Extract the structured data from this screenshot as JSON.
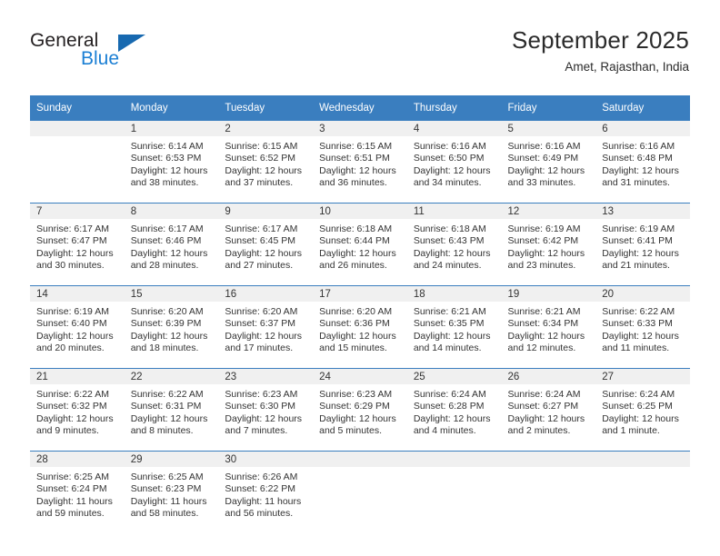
{
  "brand": {
    "name_part1": "General",
    "name_part2": "Blue",
    "triangle_icon": "triangle-icon",
    "accent_color": "#1769b0",
    "blue_text_color": "#1b7fd4"
  },
  "header": {
    "month_title": "September 2025",
    "location": "Amet, Rajasthan, India"
  },
  "calendar": {
    "header_bg_color": "#3a7ebf",
    "daynum_bg_color": "#f0f0f0",
    "weekdays": [
      "Sunday",
      "Monday",
      "Tuesday",
      "Wednesday",
      "Thursday",
      "Friday",
      "Saturday"
    ],
    "weeks": [
      [
        {
          "day": "",
          "sunrise": "",
          "sunset": "",
          "daylight_line1": "",
          "daylight_line2": "",
          "empty": true
        },
        {
          "day": "1",
          "sunrise": "Sunrise: 6:14 AM",
          "sunset": "Sunset: 6:53 PM",
          "daylight_line1": "Daylight: 12 hours",
          "daylight_line2": "and 38 minutes."
        },
        {
          "day": "2",
          "sunrise": "Sunrise: 6:15 AM",
          "sunset": "Sunset: 6:52 PM",
          "daylight_line1": "Daylight: 12 hours",
          "daylight_line2": "and 37 minutes."
        },
        {
          "day": "3",
          "sunrise": "Sunrise: 6:15 AM",
          "sunset": "Sunset: 6:51 PM",
          "daylight_line1": "Daylight: 12 hours",
          "daylight_line2": "and 36 minutes."
        },
        {
          "day": "4",
          "sunrise": "Sunrise: 6:16 AM",
          "sunset": "Sunset: 6:50 PM",
          "daylight_line1": "Daylight: 12 hours",
          "daylight_line2": "and 34 minutes."
        },
        {
          "day": "5",
          "sunrise": "Sunrise: 6:16 AM",
          "sunset": "Sunset: 6:49 PM",
          "daylight_line1": "Daylight: 12 hours",
          "daylight_line2": "and 33 minutes."
        },
        {
          "day": "6",
          "sunrise": "Sunrise: 6:16 AM",
          "sunset": "Sunset: 6:48 PM",
          "daylight_line1": "Daylight: 12 hours",
          "daylight_line2": "and 31 minutes."
        }
      ],
      [
        {
          "day": "7",
          "sunrise": "Sunrise: 6:17 AM",
          "sunset": "Sunset: 6:47 PM",
          "daylight_line1": "Daylight: 12 hours",
          "daylight_line2": "and 30 minutes."
        },
        {
          "day": "8",
          "sunrise": "Sunrise: 6:17 AM",
          "sunset": "Sunset: 6:46 PM",
          "daylight_line1": "Daylight: 12 hours",
          "daylight_line2": "and 28 minutes."
        },
        {
          "day": "9",
          "sunrise": "Sunrise: 6:17 AM",
          "sunset": "Sunset: 6:45 PM",
          "daylight_line1": "Daylight: 12 hours",
          "daylight_line2": "and 27 minutes."
        },
        {
          "day": "10",
          "sunrise": "Sunrise: 6:18 AM",
          "sunset": "Sunset: 6:44 PM",
          "daylight_line1": "Daylight: 12 hours",
          "daylight_line2": "and 26 minutes."
        },
        {
          "day": "11",
          "sunrise": "Sunrise: 6:18 AM",
          "sunset": "Sunset: 6:43 PM",
          "daylight_line1": "Daylight: 12 hours",
          "daylight_line2": "and 24 minutes."
        },
        {
          "day": "12",
          "sunrise": "Sunrise: 6:19 AM",
          "sunset": "Sunset: 6:42 PM",
          "daylight_line1": "Daylight: 12 hours",
          "daylight_line2": "and 23 minutes."
        },
        {
          "day": "13",
          "sunrise": "Sunrise: 6:19 AM",
          "sunset": "Sunset: 6:41 PM",
          "daylight_line1": "Daylight: 12 hours",
          "daylight_line2": "and 21 minutes."
        }
      ],
      [
        {
          "day": "14",
          "sunrise": "Sunrise: 6:19 AM",
          "sunset": "Sunset: 6:40 PM",
          "daylight_line1": "Daylight: 12 hours",
          "daylight_line2": "and 20 minutes."
        },
        {
          "day": "15",
          "sunrise": "Sunrise: 6:20 AM",
          "sunset": "Sunset: 6:39 PM",
          "daylight_line1": "Daylight: 12 hours",
          "daylight_line2": "and 18 minutes."
        },
        {
          "day": "16",
          "sunrise": "Sunrise: 6:20 AM",
          "sunset": "Sunset: 6:37 PM",
          "daylight_line1": "Daylight: 12 hours",
          "daylight_line2": "and 17 minutes."
        },
        {
          "day": "17",
          "sunrise": "Sunrise: 6:20 AM",
          "sunset": "Sunset: 6:36 PM",
          "daylight_line1": "Daylight: 12 hours",
          "daylight_line2": "and 15 minutes."
        },
        {
          "day": "18",
          "sunrise": "Sunrise: 6:21 AM",
          "sunset": "Sunset: 6:35 PM",
          "daylight_line1": "Daylight: 12 hours",
          "daylight_line2": "and 14 minutes."
        },
        {
          "day": "19",
          "sunrise": "Sunrise: 6:21 AM",
          "sunset": "Sunset: 6:34 PM",
          "daylight_line1": "Daylight: 12 hours",
          "daylight_line2": "and 12 minutes."
        },
        {
          "day": "20",
          "sunrise": "Sunrise: 6:22 AM",
          "sunset": "Sunset: 6:33 PM",
          "daylight_line1": "Daylight: 12 hours",
          "daylight_line2": "and 11 minutes."
        }
      ],
      [
        {
          "day": "21",
          "sunrise": "Sunrise: 6:22 AM",
          "sunset": "Sunset: 6:32 PM",
          "daylight_line1": "Daylight: 12 hours",
          "daylight_line2": "and 9 minutes."
        },
        {
          "day": "22",
          "sunrise": "Sunrise: 6:22 AM",
          "sunset": "Sunset: 6:31 PM",
          "daylight_line1": "Daylight: 12 hours",
          "daylight_line2": "and 8 minutes."
        },
        {
          "day": "23",
          "sunrise": "Sunrise: 6:23 AM",
          "sunset": "Sunset: 6:30 PM",
          "daylight_line1": "Daylight: 12 hours",
          "daylight_line2": "and 7 minutes."
        },
        {
          "day": "24",
          "sunrise": "Sunrise: 6:23 AM",
          "sunset": "Sunset: 6:29 PM",
          "daylight_line1": "Daylight: 12 hours",
          "daylight_line2": "and 5 minutes."
        },
        {
          "day": "25",
          "sunrise": "Sunrise: 6:24 AM",
          "sunset": "Sunset: 6:28 PM",
          "daylight_line1": "Daylight: 12 hours",
          "daylight_line2": "and 4 minutes."
        },
        {
          "day": "26",
          "sunrise": "Sunrise: 6:24 AM",
          "sunset": "Sunset: 6:27 PM",
          "daylight_line1": "Daylight: 12 hours",
          "daylight_line2": "and 2 minutes."
        },
        {
          "day": "27",
          "sunrise": "Sunrise: 6:24 AM",
          "sunset": "Sunset: 6:25 PM",
          "daylight_line1": "Daylight: 12 hours",
          "daylight_line2": "and 1 minute."
        }
      ],
      [
        {
          "day": "28",
          "sunrise": "Sunrise: 6:25 AM",
          "sunset": "Sunset: 6:24 PM",
          "daylight_line1": "Daylight: 11 hours",
          "daylight_line2": "and 59 minutes."
        },
        {
          "day": "29",
          "sunrise": "Sunrise: 6:25 AM",
          "sunset": "Sunset: 6:23 PM",
          "daylight_line1": "Daylight: 11 hours",
          "daylight_line2": "and 58 minutes."
        },
        {
          "day": "30",
          "sunrise": "Sunrise: 6:26 AM",
          "sunset": "Sunset: 6:22 PM",
          "daylight_line1": "Daylight: 11 hours",
          "daylight_line2": "and 56 minutes."
        },
        {
          "day": "",
          "sunrise": "",
          "sunset": "",
          "daylight_line1": "",
          "daylight_line2": "",
          "empty": true
        },
        {
          "day": "",
          "sunrise": "",
          "sunset": "",
          "daylight_line1": "",
          "daylight_line2": "",
          "empty": true
        },
        {
          "day": "",
          "sunrise": "",
          "sunset": "",
          "daylight_line1": "",
          "daylight_line2": "",
          "empty": true
        },
        {
          "day": "",
          "sunrise": "",
          "sunset": "",
          "daylight_line1": "",
          "daylight_line2": "",
          "empty": true
        }
      ]
    ]
  }
}
